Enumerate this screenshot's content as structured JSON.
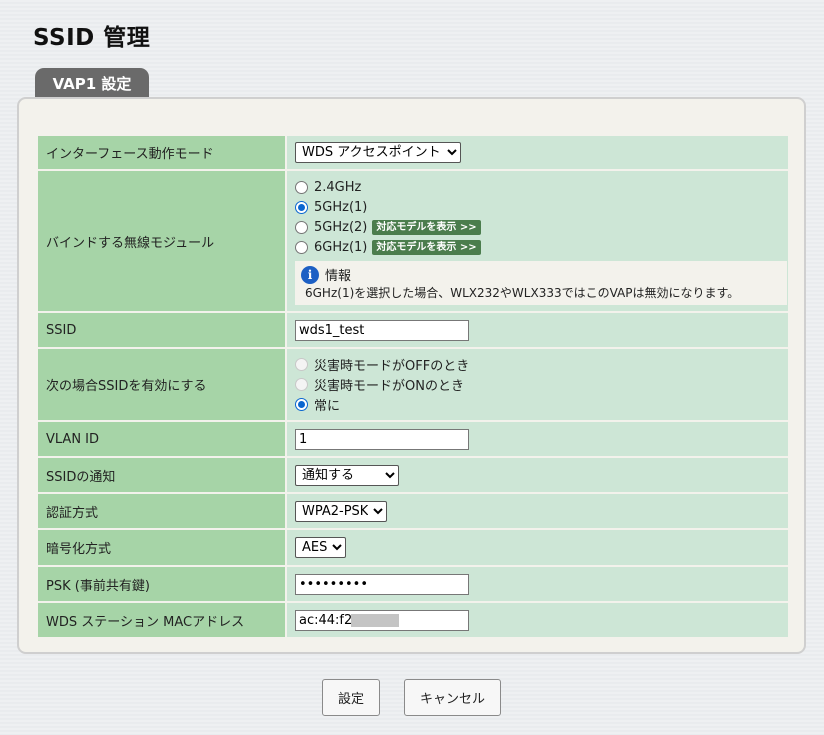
{
  "page": {
    "title": "SSID 管理"
  },
  "tab": {
    "label": "VAP1 設定"
  },
  "rows": {
    "interface_mode": {
      "label": "インターフェース動作モード",
      "selected": "WDS アクセスポイント"
    },
    "bind_module": {
      "label": "バインドする無線モジュール",
      "options": [
        "2.4GHz",
        "5GHz(1)",
        "5GHz(2)",
        "6GHz(1)"
      ],
      "selected": "5GHz(1)",
      "badge": "対応モデルを表示 >>",
      "info_title": "情報",
      "info_text": "6GHz(1)を選択した場合、WLX232やWLX333ではこのVAPは無効になります。"
    },
    "ssid": {
      "label": "SSID",
      "value": "wds1_test"
    },
    "enable_when": {
      "label": "次の場合SSIDを有効にする",
      "options": [
        "災害時モードがOFFのとき",
        "災害時モードがONのとき",
        "常に"
      ],
      "selected": "常に"
    },
    "vlan_id": {
      "label": "VLAN ID",
      "value": "1"
    },
    "ssid_notify": {
      "label": "SSIDの通知",
      "selected": "通知する"
    },
    "auth_method": {
      "label": "認証方式",
      "selected": "WPA2-PSK"
    },
    "encryption": {
      "label": "暗号化方式",
      "selected": "AES"
    },
    "psk": {
      "label": "PSK (事前共有鍵)",
      "value": "•••••••••"
    },
    "wds_mac": {
      "label": "WDS ステーション MACアドレス",
      "value": "ac:44:f2:"
    }
  },
  "buttons": {
    "apply": "設定",
    "cancel": "キャンセル"
  },
  "colors": {
    "label_bg": "#a6d4a7",
    "value_bg": "#cde6d6",
    "tab_bg": "#6a6a6a",
    "badge_bg": "#4b7d4d",
    "radio_accent": "#0b66d0"
  }
}
